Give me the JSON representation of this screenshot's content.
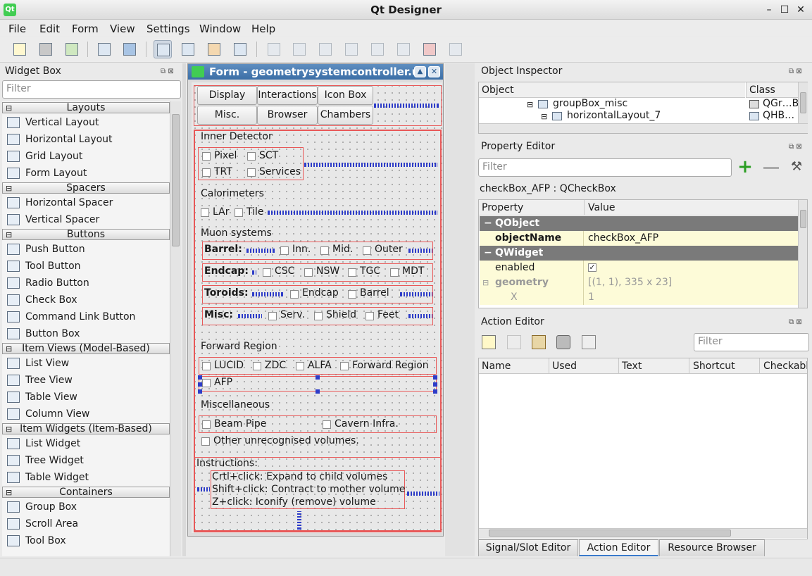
{
  "app": {
    "title": "Qt Designer",
    "logo": "Qt"
  },
  "window_buttons": {
    "minimize": "–",
    "maximize": "☐",
    "close": "✕"
  },
  "menu": [
    "File",
    "Edit",
    "Form",
    "View",
    "Settings",
    "Window",
    "Help"
  ],
  "widget_box": {
    "title": "Widget Box",
    "filter_placeholder": "Filter",
    "categories": [
      {
        "name": "Layouts",
        "items": [
          "Vertical Layout",
          "Horizontal Layout",
          "Grid Layout",
          "Form Layout"
        ]
      },
      {
        "name": "Spacers",
        "items": [
          "Horizontal Spacer",
          "Vertical Spacer"
        ]
      },
      {
        "name": "Buttons",
        "items": [
          "Push Button",
          "Tool Button",
          "Radio Button",
          "Check Box",
          "Command Link Button",
          "Button Box"
        ]
      },
      {
        "name": "Item Views (Model-Based)",
        "items": [
          "List View",
          "Tree View",
          "Table View",
          "Column View"
        ]
      },
      {
        "name": "Item Widgets (Item-Based)",
        "items": [
          "List Widget",
          "Tree Widget",
          "Table Widget"
        ]
      },
      {
        "name": "Containers",
        "items": [
          "Group Box",
          "Scroll Area",
          "Tool Box"
        ]
      }
    ]
  },
  "form": {
    "title": "Form - geometrysystemcontroller.ui",
    "tabs_row1": [
      "Display",
      "Interactions",
      "Icon Box"
    ],
    "tabs_row2": [
      "Misc.",
      "Browser",
      "Chambers"
    ],
    "inner_detector": {
      "title": "Inner Detector",
      "pixel": "Pixel",
      "sct": "SCT",
      "trt": "TRT",
      "services": "Services"
    },
    "calorimeters": {
      "title": "Calorimeters",
      "lar": "LAr",
      "tile": "Tile"
    },
    "muon": {
      "title": "Muon systems",
      "barrel": {
        "label": "Barrel:",
        "items": [
          "Inn.",
          "Mid.",
          "Outer"
        ]
      },
      "endcap": {
        "label": "Endcap:",
        "items": [
          "CSC",
          "NSW",
          "TGC",
          "MDT"
        ]
      },
      "toroids": {
        "label": "Toroids:",
        "items": [
          "Endcap",
          "Barrel"
        ]
      },
      "misc": {
        "label": "Misc:",
        "items": [
          "Serv.",
          "Shield",
          "Feet"
        ]
      }
    },
    "forward": {
      "title": "Forward Region",
      "items": [
        "LUCID",
        "ZDC",
        "ALFA",
        "Forward Region"
      ],
      "afp": "AFP"
    },
    "miscellaneous": {
      "title": "Miscellaneous",
      "beam_pipe": "Beam Pipe",
      "cavern": "Cavern Infra.",
      "other": "Other unrecognised volumes."
    },
    "instructions": {
      "title": "Instructions:",
      "line1": "Crtl+click: Expand to child volumes",
      "line2": "Shift+click: Contract to mother volume",
      "line3": "Z+click: Iconify (remove) volume"
    }
  },
  "object_inspector": {
    "title": "Object Inspector",
    "col_object": "Object",
    "col_class": "Class",
    "rows": [
      {
        "name": "groupBox_misc",
        "class": "QGr…B"
      },
      {
        "name": "horizontalLayout_7",
        "class": "QHB…"
      }
    ]
  },
  "property_editor": {
    "title": "Property Editor",
    "filter_placeholder": "Filter",
    "object_label": "checkBox_AFP : QCheckBox",
    "col_property": "Property",
    "col_value": "Value",
    "rows": [
      {
        "p": "QObject"
      },
      {
        "p": "objectName",
        "v": "checkBox_AFP"
      },
      {
        "p": "QWidget"
      },
      {
        "p": "enabled"
      },
      {
        "p": "geometry",
        "v": "[(1, 1), 335 x 23]"
      },
      {
        "p": "X",
        "v": "1"
      }
    ]
  },
  "action_editor": {
    "title": "Action Editor",
    "filter_placeholder": "Filter",
    "columns": [
      "Name",
      "Used",
      "Text",
      "Shortcut",
      "Checkable"
    ]
  },
  "bottom_tabs": [
    "Signal/Slot Editor",
    "Action Editor",
    "Resource Browser"
  ]
}
